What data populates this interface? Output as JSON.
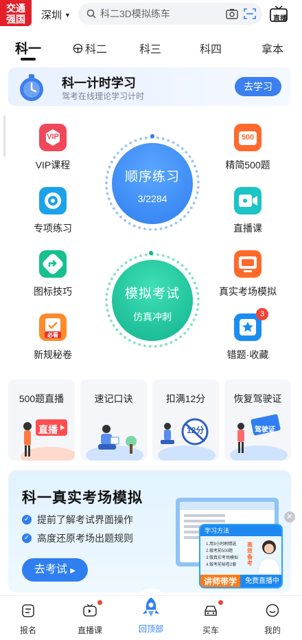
{
  "header": {
    "logo_line1": "交通",
    "logo_line2": "强国",
    "city": "深圳",
    "search_placeholder": "科二3D模拟练车",
    "live_label": "直播"
  },
  "tabs": [
    "科一",
    "科二",
    "科三",
    "科四",
    "拿本"
  ],
  "timer_banner": {
    "title": "科一计时学习",
    "subtitle": "驾考在线理论学习计时",
    "button": "去学习"
  },
  "features_left": [
    "VIP课程",
    "专项练习",
    "图标技巧",
    "新规秘卷"
  ],
  "features_right": [
    "精简500题",
    "直播课",
    "真实考场模拟",
    "错题·收藏"
  ],
  "badge_count": "3",
  "icon_texts": {
    "vip": "VIP",
    "500": "500",
    "must_see": "必看"
  },
  "practice_circle": {
    "title": "顺序练习",
    "progress": "3/2284"
  },
  "exam_circle": {
    "title": "模拟考试",
    "subtitle": "仿真冲刺"
  },
  "cards": [
    {
      "title": "500题直播",
      "art_text": "直播"
    },
    {
      "title": "速记口诀",
      "art_text": ""
    },
    {
      "title": "扣满12分",
      "art_text": "12分"
    },
    {
      "title": "恢复驾驶证",
      "art_text": "驾驶证"
    }
  ],
  "exam_banner": {
    "title": "科一真实考场模拟",
    "point1": "提前了解考试界面操作",
    "point2": "高度还原考场出题规则",
    "button": "去考试",
    "promo_header": "学习方法",
    "promo_items": [
      "1.用3小时刷精选",
      "2.做考前500题",
      "3.做真实考场模拟",
      "4.做考前秘卷2套"
    ],
    "promo_side": "高效备考",
    "promo_tag1": "讲师带学",
    "promo_tag2": "免费直播中"
  },
  "bottom_nav": [
    "报名",
    "直播课",
    "回顶部",
    "买车",
    "我的"
  ],
  "colors": {
    "accent": "#2f7ff0",
    "practice": "#3a8ef5",
    "exam": "#20c5a0",
    "red": "#e3202a"
  }
}
